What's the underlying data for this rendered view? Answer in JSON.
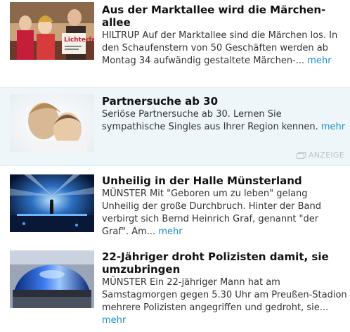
{
  "articles": [
    {
      "title": "Aus der Marktallee wird die Märchen-allee",
      "teaser": "HILTRUP Auf der Marktallee sind die Märchen los. In den Schaufenstern von 50 Geschäften werden ab Montag 34 aufwändig gestaltete Märchen-...",
      "more": "mehr",
      "image_text": "Lichterfest"
    },
    {
      "title": "Partnersuche ab 30",
      "teaser": "Seriöse Partnersuche ab 30. Lernen Sie sympathische Singles aus Ihrer Region kennen.",
      "more": "mehr",
      "badge": "ANZEIGE"
    },
    {
      "title": "Unheilig in der Halle Münsterland",
      "teaser": "MÜNSTER Mit \"Geboren um zu leben\" gelang Unheilig der große Durchbruch. Hinter der Band verbirgt sich Bernd Heinrich Graf, genannt \"der Graf\". Am...",
      "more": "mehr"
    },
    {
      "title": "22-Jähriger droht Polizisten damit, sie umzubringen",
      "teaser": "MÜNSTER Ein 22-jähriger Mann hat am Samstagmorgen gegen 5.30 Uhr am Preußen-Stadion mehrere Polizisten angegriffen und gedroht, sie...",
      "more": "mehr"
    }
  ],
  "colors": {
    "link": "#1a8fd0",
    "ad_background": "#eef6fa",
    "badge": "#b7c4cc"
  }
}
